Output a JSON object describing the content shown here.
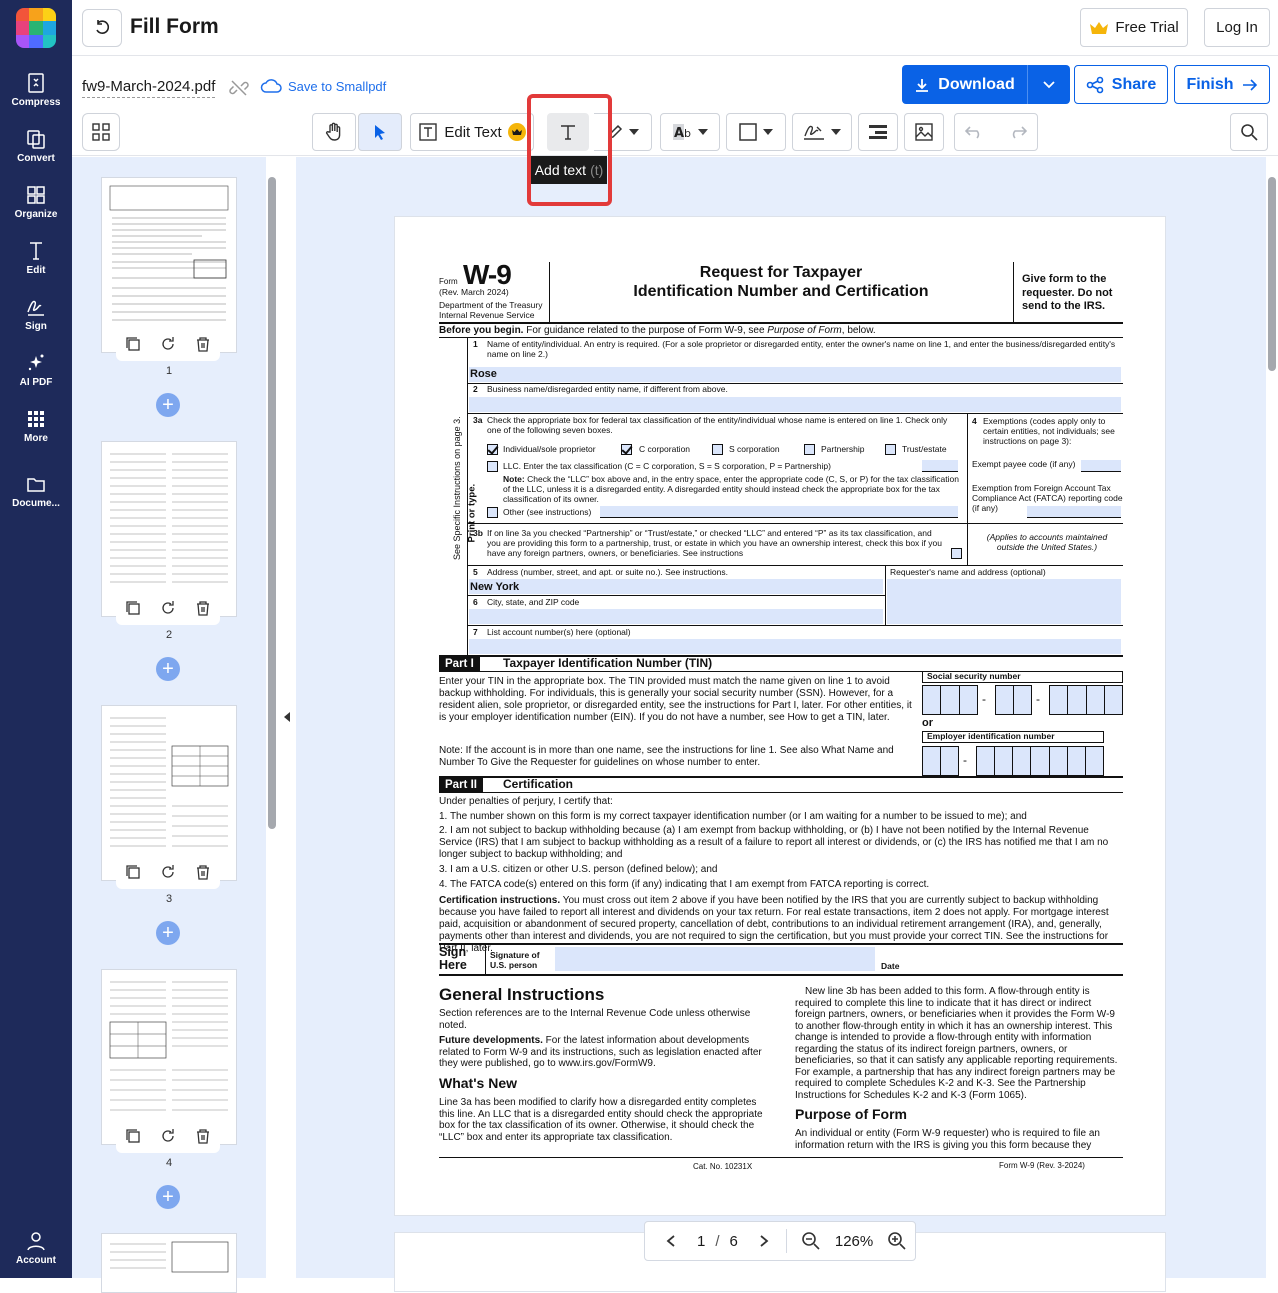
{
  "nav": {
    "items": [
      {
        "label": "Compress",
        "icon": "compress-icon"
      },
      {
        "label": "Convert",
        "icon": "convert-icon"
      },
      {
        "label": "Organize",
        "icon": "organize-icon"
      },
      {
        "label": "Edit",
        "icon": "edit-icon"
      },
      {
        "label": "Sign",
        "icon": "sign-icon"
      },
      {
        "label": "AI PDF",
        "icon": "ai-pdf-icon"
      },
      {
        "label": "More",
        "icon": "more-icon"
      },
      {
        "label": "Docume...",
        "icon": "documents-icon"
      }
    ],
    "account": "Account"
  },
  "header": {
    "title": "Fill Form",
    "free_trial": "Free Trial",
    "login": "Log In"
  },
  "file": {
    "name": "fw9-March-2024.pdf",
    "save": "Save to Smallpdf"
  },
  "actions": {
    "download": "Download",
    "share": "Share",
    "finish": "Finish"
  },
  "toolbar": {
    "edit_text": "Edit Text",
    "tooltip": "Add text",
    "tooltip_key": "(t)"
  },
  "thumbnails": {
    "pages": [
      "1",
      "2",
      "3",
      "4"
    ]
  },
  "pager": {
    "current": "1",
    "sep": "/",
    "total": "6",
    "zoom": "126%"
  },
  "colors": {
    "brand": "#0a62e6",
    "nav_bg": "#1e2a5a",
    "highlight": "#e23a3a",
    "field_fill": "#dbe6fb"
  },
  "form": {
    "form_word": "Form",
    "form_name": "W-9",
    "rev": "(Rev. March 2024)",
    "dept1": "Department of the Treasury",
    "dept2": "Internal Revenue Service",
    "title1": "Request for Taxpayer",
    "title2": "Identification Number and Certification",
    "give1": "Give form to the",
    "give2": "requester. Do not",
    "give3": "send to the IRS.",
    "before_b": "Before you begin.",
    "before_t": " For guidance related to the purpose of Form W-9, see ",
    "before_i": "Purpose of Form",
    "before_e": ", below.",
    "l1": "Name of entity/individual. An entry is required. (For a sole proprietor or disregarded entity, enter the owner's name on line 1, and enter the business/disregarded entity's name on line 2.)",
    "l1_val": "Rose",
    "l2": "Business name/disregarded entity name, if different from above.",
    "l3a": "Check the appropriate box for federal tax classification of the entity/individual whose name is entered on line 1. Check only one of the following seven boxes.",
    "c_ind": "Individual/sole proprietor",
    "c_ccorp": "C corporation",
    "c_scorp": "S corporation",
    "c_part": "Partnership",
    "c_trust": "Trust/estate",
    "c_llc": "LLC. Enter the tax classification (C = C corporation, S = S corporation, P = Partnership)",
    "note_b": "Note:",
    "note_t": " Check the “LLC” box above and, in the entry space, enter the appropriate code (C, S, or P) for the tax classification of the LLC, unless it is a disregarded entity. A disregarded entity should instead check the appropriate box for the tax classification of its owner.",
    "other": "Other (see instructions)",
    "l3b": "If on line 3a you checked “Partnership” or “Trust/estate,” or checked “LLC” and entered “P” as its tax classification, and you are providing this form to a partnership, trust, or estate in which you have an ownership interest, check this box if you have any foreign partners, owners, or beneficiaries. See instructions",
    "l4": "Exemptions (codes apply only to certain entities, not individuals; see instructions on page 3):",
    "exempt_payee": "Exempt payee code (if any)",
    "fatca": "Exemption from Foreign Account Tax Compliance Act (FATCA) reporting code (if any)",
    "applies": "(Applies to accounts maintained outside the United States.)",
    "l5": "Address (number, street, and apt. or suite no.). See instructions.",
    "l5_val": "New York",
    "requester": "Requester's name and address (optional)",
    "l6": "City, state, and ZIP code",
    "l7": "List account number(s) here (optional)",
    "side1": "Print or type.",
    "side2": "See Specific Instructions on page 3.",
    "part1": "Part I",
    "part1_title": "Taxpayer Identification Number (TIN)",
    "tin_text": "Enter your TIN in the appropriate box. The TIN provided must match the name given on line 1 to avoid backup withholding. For individuals, this is generally your social security number (SSN). However, for a resident alien, sole proprietor, or disregarded entity, see the instructions for Part I, later. For other entities, it is your employer identification number (EIN). If you do not have a number, see How to get a TIN, later.",
    "tin_note": "Note: If the account is in more than one name, see the instructions for line 1. See also What Name and Number To Give the Requester for guidelines on whose number to enter.",
    "ssn": "Social security number",
    "or": "or",
    "ein": "Employer identification number",
    "part2": "Part II",
    "part2_title": "Certification",
    "cert_intro": "Under penalties of perjury, I certify that:",
    "cert1": "1. The number shown on this form is my correct taxpayer identification number (or I am waiting for a number to be issued to me); and",
    "cert2": "2. I am not subject to backup withholding because (a) I am exempt from backup withholding, or (b) I have not been notified by the Internal Revenue Service (IRS) that I am subject to backup withholding as a result of a failure to report all interest or dividends, or (c) the IRS has notified me that I am no longer subject to backup withholding; and",
    "cert3": "3. I am a U.S. citizen or other U.S. person (defined below); and",
    "cert4": "4. The FATCA code(s) entered on this form (if any) indicating that I am exempt from FATCA reporting is correct.",
    "cert_instr_b": "Certification instructions.",
    "cert_instr": " You must cross out item 2 above if you have been notified by the IRS that you are currently subject to backup withholding because you have failed to report all interest and dividends on your tax return. For real estate transactions, item 2 does not apply. For mortgage interest paid, acquisition or abandonment of secured property, cancellation of debt, contributions to an individual retirement arrangement (IRA), and, generally, payments other than interest and dividends, you are not required to sign the certification, but you must provide your correct TIN. See the instructions for Part II, later.",
    "sign": "Sign Here",
    "sig_of": "Signature of U.S. person",
    "date": "Date",
    "gi_title": "General Instructions",
    "gi_text": "Section references are to the Internal Revenue Code unless otherwise noted.",
    "fd_b": "Future developments.",
    "fd_t": " For the latest information about developments related to Form W-9 and its instructions, such as legislation enacted after they were published, go to www.irs.gov/FormW9.",
    "wn_title": "What's New",
    "wn_text": "Line 3a has been modified to clarify how a disregarded entity completes this line. An LLC that is a disregarded entity should check the appropriate box for the tax classification of its owner. Otherwise, it should check the “LLC” box and enter its appropriate tax classification.",
    "rc_text": "New line 3b has been added to this form. A flow-through entity is required to complete this line to indicate that it has direct or indirect foreign partners, owners, or beneficiaries when it provides the Form W-9 to another flow-through entity in which it has an ownership interest. This change is intended to provide a flow-through entity with information regarding the status of its indirect foreign partners, owners, or beneficiaries, so that it can satisfy any applicable reporting requirements. For example, a partnership that has any indirect foreign partners may be required to complete Schedules K-2 and K-3. See the Partnership Instructions for Schedules K-2 and K-3 (Form 1065).",
    "pf_title": "Purpose of Form",
    "pf_text": "An individual or entity (Form W-9 requester) who is required to file an information return with the IRS is giving you this form because they",
    "cat": "Cat. No. 10231X",
    "footer": "Form W-9 (Rev. 3-2024)"
  }
}
